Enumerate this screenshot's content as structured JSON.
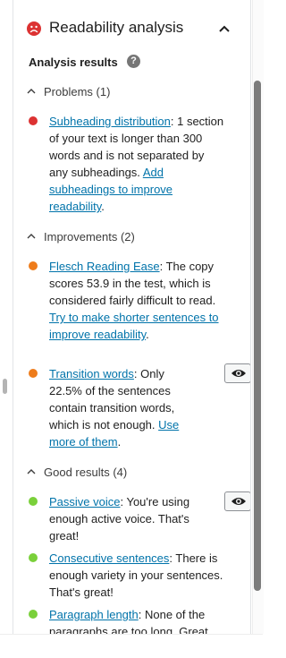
{
  "header": {
    "title": "Readability analysis",
    "status_icon": "sad-face-icon",
    "status_color": "#dc3232"
  },
  "results_label": "Analysis results",
  "help_glyph": "?",
  "groups": {
    "problems": {
      "label": "Problems (1)"
    },
    "improvements": {
      "label": "Improvements (2)"
    },
    "good": {
      "label": "Good results (4)"
    }
  },
  "items": {
    "subheading": {
      "color": "#dc3232",
      "title": "Subheading distribution",
      "text": ": 1 section of your text is longer than 300 words and is not separated by any subheadings. ",
      "link": "Add subheadings to improve readability",
      "tail": "."
    },
    "flesch": {
      "color": "#ee7c1b",
      "title": "Flesch Reading Ease",
      "text": ": The copy scores 53.9 in the test, which is considered fairly difficult to read. ",
      "link": "Try to make shorter sentences to improve readability",
      "tail": "."
    },
    "transition": {
      "color": "#ee7c1b",
      "title": "Transition words",
      "text": ": Only 22.5% of the sentences contain transition words, which is not enough. ",
      "link": "Use more of them",
      "tail": "."
    },
    "passive": {
      "color": "#7ad03a",
      "title": "Passive voice",
      "text": ": You're using enough active voice. That's great!"
    },
    "consecutive": {
      "color": "#7ad03a",
      "title": "Consecutive sentences",
      "text": ": There is enough variety in your sentences. That's great!"
    },
    "paragraph": {
      "color": "#7ad03a",
      "title": "Paragraph length",
      "text": ": None of the paragraphs are too long. Great job!"
    }
  }
}
